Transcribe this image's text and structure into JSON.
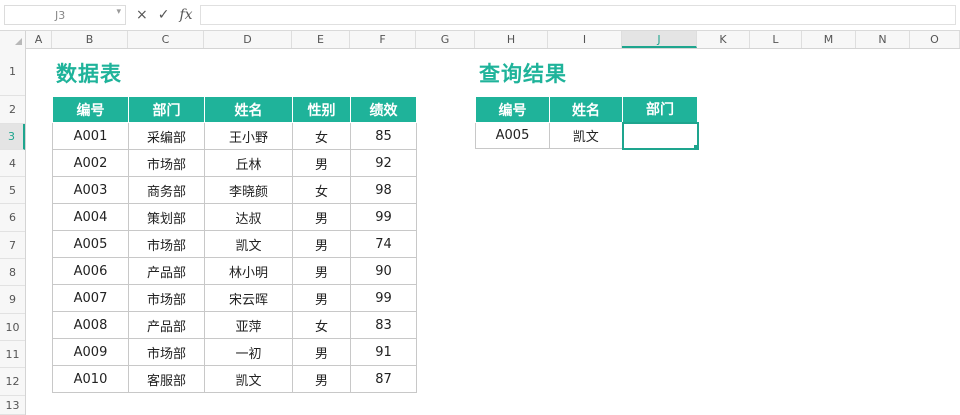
{
  "formula_bar": {
    "name_box": "J3",
    "cancel_icon": "×",
    "enter_icon": "✓",
    "fx_label": "fx",
    "formula": ""
  },
  "columns": [
    "A",
    "B",
    "C",
    "D",
    "E",
    "F",
    "G",
    "H",
    "I",
    "J",
    "K",
    "L",
    "M",
    "N",
    "O"
  ],
  "selected_column": "J",
  "rows": [
    "1",
    "2",
    "3",
    "4",
    "5",
    "6",
    "7",
    "8",
    "9",
    "10",
    "11",
    "12",
    "13"
  ],
  "selected_row": "3",
  "data_table": {
    "title": "数据表",
    "headers": [
      "编号",
      "部门",
      "姓名",
      "性别",
      "绩效"
    ],
    "rows": [
      [
        "A001",
        "采编部",
        "王小野",
        "女",
        "85"
      ],
      [
        "A002",
        "市场部",
        "丘林",
        "男",
        "92"
      ],
      [
        "A003",
        "商务部",
        "李晓颜",
        "女",
        "98"
      ],
      [
        "A004",
        "策划部",
        "达叔",
        "男",
        "99"
      ],
      [
        "A005",
        "市场部",
        "凯文",
        "男",
        "74"
      ],
      [
        "A006",
        "产品部",
        "林小明",
        "男",
        "90"
      ],
      [
        "A007",
        "市场部",
        "宋云晖",
        "男",
        "99"
      ],
      [
        "A008",
        "产品部",
        "亚萍",
        "女",
        "83"
      ],
      [
        "A009",
        "市场部",
        "一初",
        "男",
        "91"
      ],
      [
        "A010",
        "客服部",
        "凯文",
        "男",
        "87"
      ]
    ]
  },
  "query_table": {
    "title": "查询结果",
    "headers": [
      "编号",
      "姓名",
      "部门"
    ],
    "rows": [
      [
        "A005",
        "凯文",
        ""
      ]
    ]
  },
  "colors": {
    "accent": "#1fb39a",
    "selection": "#1ea58e"
  }
}
